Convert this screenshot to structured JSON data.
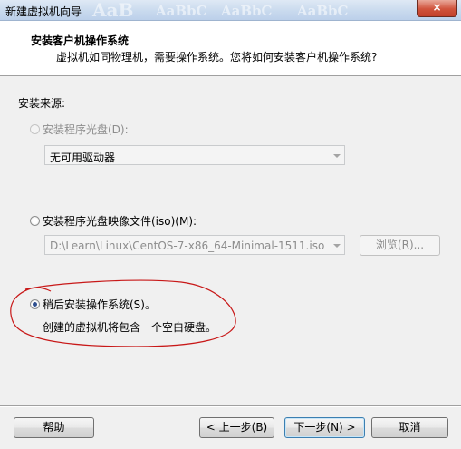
{
  "window": {
    "title": "新建虚拟机向导",
    "ghost_texts": [
      "AaB",
      "AaBbC",
      "AaBbC",
      "AaBbC"
    ],
    "close_glyph": "×"
  },
  "header": {
    "title": "安装客户机操作系统",
    "subtitle": "虚拟机如同物理机，需要操作系统。您将如何安装客户机操作系统?"
  },
  "source": {
    "group_label": "安装来源:",
    "options": [
      {
        "label": "安装程序光盘(D):",
        "selected": false,
        "enabled": false
      },
      {
        "label": "安装程序光盘映像文件(iso)(M):",
        "selected": false,
        "enabled": true
      },
      {
        "label": "稍后安装操作系统(S)。",
        "selected": true,
        "enabled": true
      }
    ],
    "disc_combo_value": "无可用驱动器",
    "iso_combo_value": "D:\\Learn\\Linux\\CentOS-7-x86_64-Minimal-1511.iso",
    "browse_label": "浏览(R)...",
    "later_description": "创建的虚拟机将包含一个空白硬盘。"
  },
  "footer": {
    "help": "帮助",
    "back": "< 上一步(B)",
    "next": "下一步(N) >",
    "cancel": "取消"
  },
  "colors": {
    "annotation_red": "#c81818",
    "header_bg": "#ffffff",
    "dialog_bg": "#f0f0f0"
  }
}
